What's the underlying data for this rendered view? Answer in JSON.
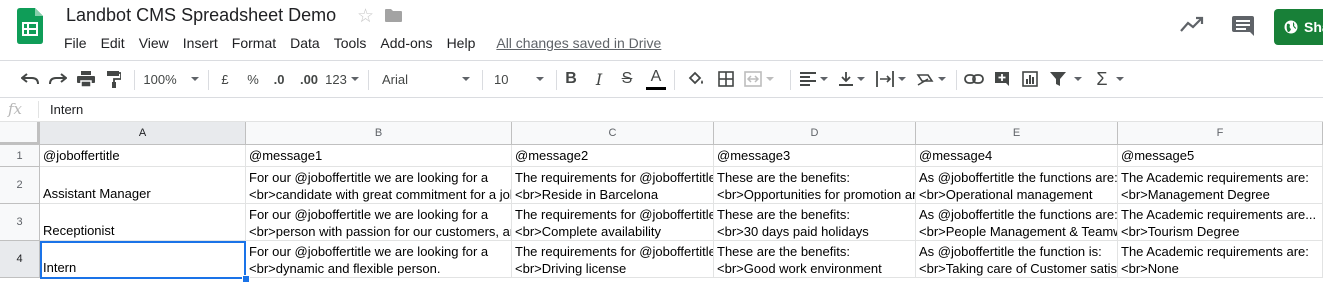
{
  "window": {
    "doc_title": "Landbot CMS Spreadsheet Demo",
    "save_status": "All changes saved in Drive",
    "share_label": "Share",
    "brand_color": "#188038"
  },
  "menu": [
    "File",
    "Edit",
    "View",
    "Insert",
    "Format",
    "Data",
    "Tools",
    "Add-ons",
    "Help"
  ],
  "toolbar": {
    "zoom": "100%",
    "currency": "£",
    "percent": "%",
    "decrease_decimals": ".0",
    "increase_decimals": ".00",
    "more_formats": "123",
    "font_family": "Arial",
    "font_size": "10",
    "icons": [
      "undo-icon",
      "redo-icon",
      "print-icon",
      "paint-format-icon",
      "bold-icon",
      "italic-icon",
      "strikethrough-icon",
      "text-color-icon",
      "fill-color-icon",
      "borders-icon",
      "merge-icon",
      "align-icon",
      "valign-icon",
      "wrap-icon",
      "rotate-icon",
      "link-icon",
      "comment-add-icon",
      "chart-icon",
      "filter-icon",
      "function-icon"
    ]
  },
  "formula_bar": {
    "fx": "fx",
    "value": "Intern"
  },
  "sheet": {
    "columns": [
      "A",
      "B",
      "C",
      "D",
      "E",
      "F"
    ],
    "rows": [
      "1",
      "2",
      "3",
      "4"
    ],
    "cells": [
      [
        "@joboffertitle",
        "@message1",
        "@message2",
        "@message3",
        "@message4",
        "@message5"
      ],
      [
        "Assistant Manager",
        "For our @joboffertitle we are looking for a\n<br>candidate with great commitment for a job",
        "The requirements for @joboffertitle are:\n<br>Reside in Barcelona",
        "These are the benefits:\n<br>Opportunities for promotion and",
        "As @joboffertitle the functions are:\n<br>Operational management",
        "The Academic requirements are:\n<br>Management Degree"
      ],
      [
        "Receptionist",
        "For our @joboffertitle we are looking for a\n<br>person with passion for our customers, and",
        "The requirements for @joboffertitle are:\n<br>Complete availability",
        "These are the benefits:\n<br>30 days paid holidays",
        "As @joboffertitle the functions are:\n<br>People Management & Teamwork",
        "The Academic requirements are...\n<br>Tourism Degree"
      ],
      [
        "Intern",
        "For our @joboffertitle we are looking for a\n<br>dynamic and flexible person.",
        "The requirements for @joboffertitle are:\n<br>Driving license",
        "These are the benefits:\n<br>Good work environment",
        "As @joboffertitle the function is:\n<br>Taking care of Customer satisfaction",
        "The Academic requirements are:\n<br>None"
      ]
    ],
    "selected_cell": "A4"
  }
}
